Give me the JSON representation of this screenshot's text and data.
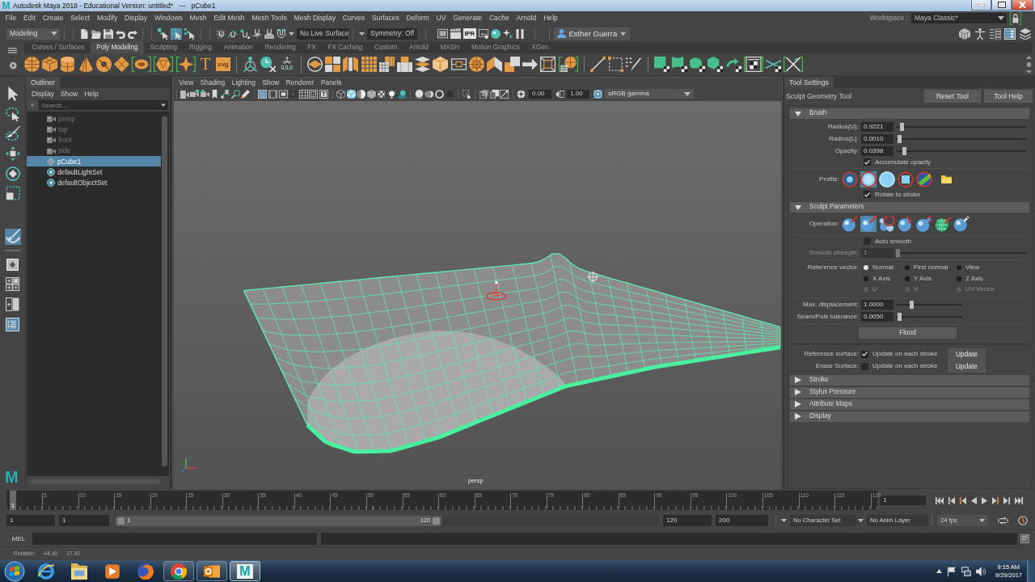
{
  "window": {
    "logo": "M",
    "title": "Autodesk Maya 2018 - Educational Version: untitled*   ---   pCube1"
  },
  "menu_bar": {
    "items": [
      "File",
      "Edit",
      "Create",
      "Select",
      "Modify",
      "Display",
      "Windows",
      "Mesh",
      "Edit Mesh",
      "Mesh Tools",
      "Mesh Display",
      "Curves",
      "Surfaces",
      "Deform",
      "UV",
      "Generate",
      "Cache",
      "Arnold",
      "Help"
    ],
    "workspace_label": "Workspace :",
    "workspace": "Maya Classic*"
  },
  "status_line": {
    "menu_set": "Modeling",
    "select_modes": [
      {
        "selected": false
      },
      {
        "selected": true
      },
      {
        "selected": false
      }
    ],
    "live_surface": "No Live Surface",
    "symmetry": "Symmetry: Off",
    "render_icon_text": "IPR",
    "user": "Esther Guerra",
    "panel_toggles": [
      {
        "selected": false
      },
      {
        "selected": false
      },
      {
        "selected": false
      },
      {
        "selected": true
      },
      {
        "selected": false
      }
    ]
  },
  "shelf": {
    "tabs": [
      {
        "label": "Curves / Surfaces",
        "selected": false
      },
      {
        "label": "Poly Modeling",
        "selected": true
      },
      {
        "label": "Sculpting",
        "selected": false
      },
      {
        "label": "Rigging",
        "selected": false
      },
      {
        "label": "Animation",
        "selected": false
      },
      {
        "label": "Rendering",
        "selected": false
      },
      {
        "label": "FX",
        "selected": false
      },
      {
        "label": "FX Caching",
        "selected": false
      },
      {
        "label": "Custom",
        "selected": false
      },
      {
        "label": "Arnold",
        "selected": false
      },
      {
        "label": "MASH",
        "selected": false
      },
      {
        "label": "Motion Graphics",
        "selected": false
      },
      {
        "label": "XGen",
        "selected": false
      }
    ],
    "icon_texts": [
      "T",
      "svg",
      "0,0,0"
    ]
  },
  "toolbox": {
    "tools": [
      {
        "selected": false
      },
      {
        "selected": false
      },
      {
        "selected": false
      },
      {
        "selected": false
      },
      {
        "selected": false
      },
      {
        "selected": false
      },
      {
        "selected": true
      }
    ],
    "layouts": [
      {
        "selected": false
      },
      {
        "selected": false
      },
      {
        "selected": false
      },
      {
        "selected": true
      }
    ],
    "logo": "M"
  },
  "outliner": {
    "title": "Outliner",
    "menus": [
      "Display",
      "Show",
      "Help"
    ],
    "search": {
      "placeholder": "Search..."
    },
    "items": [
      {
        "label": "persp",
        "kind": "camera",
        "hidden": true,
        "selected": false
      },
      {
        "label": "top",
        "kind": "camera",
        "hidden": true,
        "selected": false
      },
      {
        "label": "front",
        "kind": "camera",
        "hidden": true,
        "selected": false
      },
      {
        "label": "side",
        "kind": "camera",
        "hidden": true,
        "selected": false
      },
      {
        "label": "pCube1",
        "kind": "mesh",
        "hidden": false,
        "selected": true
      },
      {
        "label": "defaultLightSet",
        "kind": "set",
        "hidden": false,
        "selected": false
      },
      {
        "label": "defaultObjectSet",
        "kind": "set",
        "hidden": false,
        "selected": false
      }
    ]
  },
  "viewport": {
    "menus": [
      "View",
      "Shading",
      "Lighting",
      "Show",
      "Renderer",
      "Panels"
    ],
    "toggles": [
      {
        "selected": false
      },
      {
        "selected": false
      },
      {
        "selected": false
      },
      {
        "selected": false
      },
      {
        "selected": false
      },
      {
        "selected": false
      },
      {
        "selected": false
      },
      {
        "selected": true
      },
      {
        "selected": false
      },
      {
        "selected": false
      },
      {
        "selected": false
      },
      {
        "selected": false
      },
      {
        "selected": false
      },
      {
        "selected": false
      },
      {
        "selected": false
      },
      {
        "selected": true
      },
      {
        "selected": false
      },
      {
        "selected": false
      },
      {
        "selected": false
      },
      {
        "selected": false
      },
      {
        "selected": false
      },
      {
        "selected": false
      },
      {
        "selected": false
      },
      {
        "selected": false
      },
      {
        "selected": false
      },
      {
        "selected": false
      },
      {
        "selected": false
      },
      {
        "selected": false
      },
      {
        "selected": false
      },
      {
        "selected": false
      },
      {
        "selected": false
      },
      {
        "selected": true
      }
    ],
    "exposure": "0.00",
    "gamma": "1.00",
    "color_space": "sRGB gamma",
    "camera": "persp"
  },
  "tool_settings": {
    "title": "Tool Settings",
    "tool_name": "Sculpt Geometry Tool",
    "buttons": [
      "Reset Tool",
      "Tool Help"
    ],
    "brush": {
      "title": "Brush",
      "expanded": true,
      "sliders": [
        {
          "label": "Radius(U):",
          "value": "0.9221",
          "level": 0.03
        },
        {
          "label": "Radius(L):",
          "value": "0.0010",
          "level": 0.01
        },
        {
          "label": "Opacity:",
          "value": "0.0398",
          "level": 0.05
        }
      ],
      "accumulate_opacity": {
        "label": "Accumulate opacity",
        "checked": true
      },
      "profile": {
        "label": "Profile:",
        "options": [
          {
            "selected": false
          },
          {
            "selected": true
          },
          {
            "selected": false
          },
          {
            "selected": false
          },
          {
            "selected": false
          }
        ]
      },
      "rotate_to_stroke": {
        "label": "Rotate to stroke",
        "checked": true
      }
    },
    "sculpt_parameters": {
      "title": "Sculpt Parameters",
      "expanded": true,
      "operation": {
        "label": "Operation:",
        "options": [
          {
            "selected": false
          },
          {
            "selected": true
          },
          {
            "selected": false
          },
          {
            "selected": false
          },
          {
            "selected": false
          },
          {
            "selected": false
          },
          {
            "selected": false
          }
        ]
      },
      "auto_smooth": {
        "label": "Auto smooth",
        "checked": false
      },
      "smooth_strength": {
        "label": "Smooth strength:",
        "value": "1",
        "level": 0.0,
        "disabled": true
      },
      "reference_vector": {
        "label": "Reference vector:",
        "options": [
          {
            "label": "Normal",
            "selected": true,
            "disabled": false
          },
          {
            "label": "First normal",
            "selected": false,
            "disabled": false
          },
          {
            "label": "View",
            "selected": false,
            "disabled": false
          },
          {
            "label": "X Axis",
            "selected": false,
            "disabled": false
          },
          {
            "label": "Y Axis",
            "selected": false,
            "disabled": false
          },
          {
            "label": "Z Axis",
            "selected": false,
            "disabled": false
          },
          {
            "label": "U",
            "selected": false,
            "disabled": true
          },
          {
            "label": "V",
            "selected": false,
            "disabled": true
          },
          {
            "label": "UV Vector",
            "selected": false,
            "disabled": true
          }
        ]
      },
      "max_displacement": {
        "label": "Max. displacement:",
        "value": "1.0000",
        "level": 0.22,
        "disabled": false
      },
      "seam_tolerance": {
        "label": "Seam/Pole tolerance:",
        "value": "0.0050",
        "level": 0.03,
        "disabled": false
      },
      "flood": "Flood",
      "reference_surface": {
        "label": "Reference surface:",
        "option": "Update on each stroke",
        "checked": true,
        "button": "Update"
      },
      "erase_surface": {
        "label": "Erase Surface:",
        "option": "Update on each stroke",
        "checked": false,
        "button": "Update"
      }
    },
    "collapsed_sections": [
      {
        "title": "Stroke",
        "expanded": false
      },
      {
        "title": "Stylus Pressure",
        "expanded": false
      },
      {
        "title": "Attribute Maps",
        "expanded": false
      },
      {
        "title": "Display",
        "expanded": false
      }
    ]
  },
  "time_slider": {
    "current_frame": "1",
    "level": 0.0,
    "ticks": [
      "5",
      "10",
      "15",
      "20",
      "25",
      "30",
      "35",
      "40",
      "45",
      "50",
      "55",
      "60",
      "65",
      "70",
      "75",
      "80",
      "85",
      "90",
      "95",
      "100",
      "105",
      "110",
      "115",
      "120"
    ],
    "frame_field": "1"
  },
  "range_slider": {
    "start": "1",
    "playback_start": "1",
    "level": 0.6,
    "handle_start": "1",
    "handle_end": "120",
    "playback_end": "120",
    "end": "200",
    "character_set": "No Character Set",
    "anim_layer": "No Anim Layer",
    "fps": "24 fps"
  },
  "command_line": {
    "language": "MEL"
  },
  "help_line": {
    "label": "Rotation:",
    "values": [
      "-44.40",
      "-17.40"
    ]
  },
  "taskbar": {
    "apps": [
      {
        "running": false,
        "selected": false
      },
      {
        "running": false,
        "selected": false
      },
      {
        "running": false,
        "selected": false
      },
      {
        "running": false,
        "selected": false
      },
      {
        "running": true,
        "selected": false
      },
      {
        "running": true,
        "selected": false
      },
      {
        "running": true,
        "selected": true,
        "logo": "M"
      }
    ],
    "time": "9:15 AM",
    "date": "9/29/2017"
  }
}
